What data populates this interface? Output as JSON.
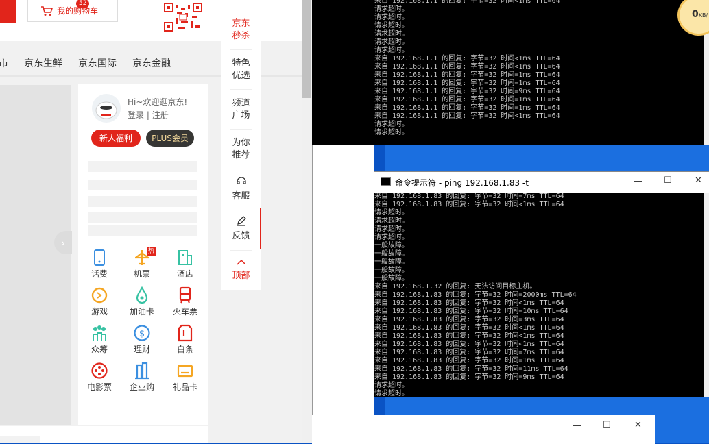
{
  "browser": {
    "cart": {
      "count": "52",
      "label": "我的购物车"
    },
    "nav": [
      "市",
      "京东生鲜",
      "京东国际",
      "京东金融"
    ],
    "user": {
      "greeting": "Hi~欢迎逛京东!",
      "login": "登录",
      "divider": "|",
      "register": "注册",
      "newuser_label": "新人福利",
      "plus_label": "PLUS会员"
    },
    "services": [
      {
        "label": "话费",
        "icon": "phone-icon",
        "color": "#3b8fe0"
      },
      {
        "label": "机票",
        "icon": "plane-icon",
        "color": "#f5a623",
        "hot": "热"
      },
      {
        "label": "酒店",
        "icon": "hotel-icon",
        "color": "#37c2a3"
      },
      {
        "label": "游戏",
        "icon": "game-icon",
        "color": "#f5a623"
      },
      {
        "label": "加油卡",
        "icon": "fuel-icon",
        "color": "#37c2a3"
      },
      {
        "label": "火车票",
        "icon": "train-icon",
        "color": "#e1251b"
      },
      {
        "label": "众筹",
        "icon": "crowdfund-icon",
        "color": "#37c2a3"
      },
      {
        "label": "理财",
        "icon": "finance-icon",
        "color": "#3b8fe0"
      },
      {
        "label": "白条",
        "icon": "credit-icon",
        "color": "#e1251b"
      },
      {
        "label": "电影票",
        "icon": "movie-icon",
        "color": "#e1251b"
      },
      {
        "label": "企业购",
        "icon": "enterprise-icon",
        "color": "#3b8fe0"
      },
      {
        "label": "礼品卡",
        "icon": "giftcard-icon",
        "color": "#f5a623"
      }
    ],
    "sidebar": {
      "seckill": [
        "京东",
        "秒杀"
      ],
      "featured": [
        "特色",
        "优选"
      ],
      "channel": [
        "频道",
        "广场"
      ],
      "recommend": [
        "为你",
        "推荐"
      ],
      "service": "客服",
      "feedback": "反馈",
      "top": "顶部"
    }
  },
  "console1": {
    "lines": [
      "来自 192.168.1.1 的回复: 字节=32 时间<1ms TTL=64",
      "请求超时。",
      "请求超时。",
      "请求超时。",
      "请求超时。",
      "请求超时。",
      "请求超时。",
      "来自 192.168.1.1 的回复: 字节=32 时间<1ms TTL=64",
      "来自 192.168.1.1 的回复: 字节=32 时间<1ms TTL=64",
      "来自 192.168.1.1 的回复: 字节=32 时间=1ms TTL=64",
      "来自 192.168.1.1 的回复: 字节=32 时间=1ms TTL=64",
      "来自 192.168.1.1 的回复: 字节=32 时间=9ms TTL=64",
      "来自 192.168.1.1 的回复: 字节=32 时间=1ms TTL=64",
      "来自 192.168.1.1 的回复: 字节=32 时间=1ms TTL=64",
      "来自 192.168.1.1 的回复: 字节=32 时间<1ms TTL=64",
      "请求超时。",
      "请求超时。"
    ]
  },
  "console2": {
    "title": "命令提示符 - ping  192.168.1.83 -t",
    "lines": [
      "来自 192.168.1.83 的回复: 字节=32 时间=7ms TTL=64",
      "来自 192.168.1.83 的回复: 字节=32 时间<1ms TTL=64",
      "请求超时。",
      "请求超时。",
      "请求超时。",
      "请求超时。",
      "一般故障。",
      "一般故障。",
      "一般故障。",
      "一般故障。",
      "一般故障。",
      "来自 192.168.1.32 的回复: 无法访问目标主机。",
      "来自 192.168.1.83 的回复: 字节=32 时间=2000ms TTL=64",
      "来自 192.168.1.83 的回复: 字节=32 时间<1ms TTL=64",
      "来自 192.168.1.83 的回复: 字节=32 时间=10ms TTL=64",
      "来自 192.168.1.83 的回复: 字节=32 时间=3ms TTL=64",
      "来自 192.168.1.83 的回复: 字节=32 时间<1ms TTL=64",
      "来自 192.168.1.83 的回复: 字节=32 时间<1ms TTL=64",
      "来自 192.168.1.83 的回复: 字节=32 时间<1ms TTL=64",
      "来自 192.168.1.83 的回复: 字节=32 时间=7ms TTL=64",
      "来自 192.168.1.83 的回复: 字节=32 时间=1ms TTL=64",
      "来自 192.168.1.83 的回复: 字节=32 时间=11ms TTL=64",
      "来自 192.168.1.83 的回复: 字节=32 时间=9ms TTL=64",
      "请求超时。",
      "请求超时。"
    ]
  },
  "window_controls": {
    "minimize": "—",
    "maximize": "☐",
    "close": "✕"
  },
  "speed_badge": {
    "value": "0",
    "unit": "KB/"
  }
}
